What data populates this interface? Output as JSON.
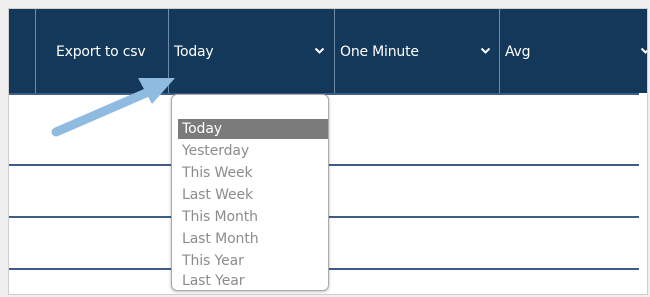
{
  "toolbar": {
    "export_label": "Export to csv",
    "date_range": {
      "selected": "Today"
    },
    "interval": {
      "selected": "One Minute"
    },
    "aggregate": {
      "selected": "Avg"
    }
  },
  "dropdown": {
    "options": [
      "Today",
      "Yesterday",
      "This Week",
      "Last Week",
      "This Month",
      "Last Month",
      "This Year",
      "Last Year"
    ],
    "selected_index": 0
  },
  "colors": {
    "toolbar_bg": "#13385a",
    "row_line": "#3f5e86",
    "selected_option_bg": "#7b7b7b",
    "arrow": "#8fbbe0"
  }
}
